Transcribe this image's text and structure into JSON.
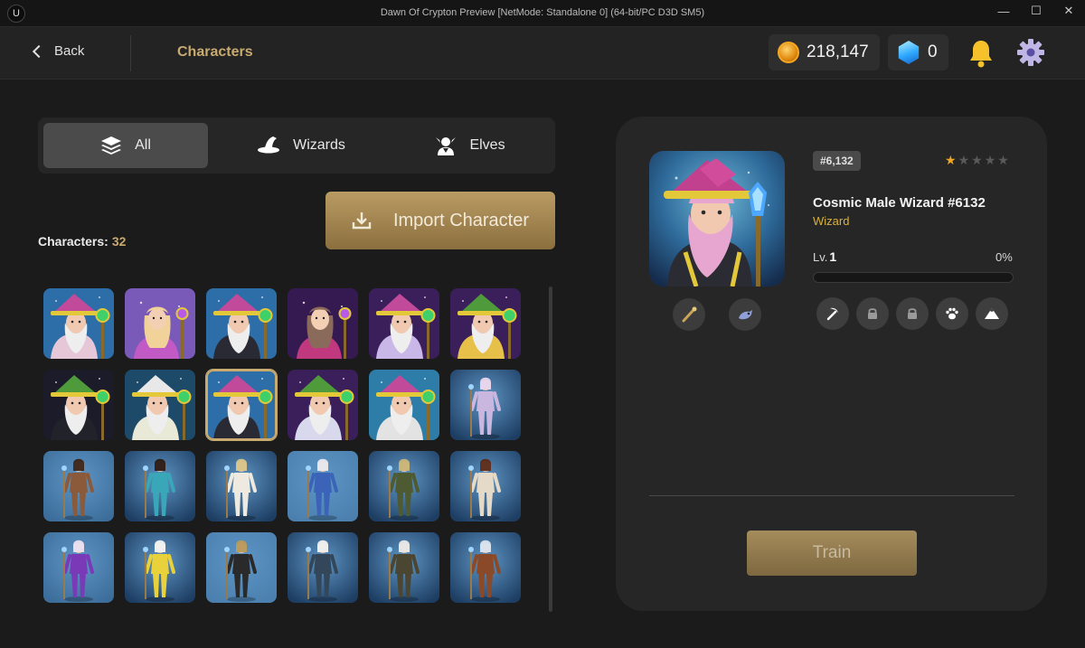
{
  "window": {
    "title": "Dawn Of Crypton Preview [NetMode: Standalone 0]  (64-bit/PC D3D SM5)",
    "logo": "U"
  },
  "header": {
    "back_label": "Back",
    "page_title": "Characters",
    "coins": "218,147",
    "gems": "0"
  },
  "tabs": [
    {
      "label": "All",
      "icon": "layers-icon",
      "active": true
    },
    {
      "label": "Wizards",
      "icon": "wizard-hat-icon",
      "active": false
    },
    {
      "label": "Elves",
      "icon": "elf-icon",
      "active": false
    }
  ],
  "import_label": "Import Character",
  "characters": {
    "label": "Characters:",
    "count": "32",
    "grid": [
      {
        "type": "wizard",
        "hat": "#c24a9a",
        "robe": "#e6c7d7",
        "bg": "#2d6ea8"
      },
      {
        "type": "sorceress",
        "hat": "#f1d39a",
        "robe": "#c25ac6",
        "bg": "#7a5ab8"
      },
      {
        "type": "wizard",
        "hat": "#c24a9a",
        "robe": "#2a2a35",
        "bg": "#2d6ea8"
      },
      {
        "type": "sorceress",
        "hat": "#8a6a5a",
        "robe": "#c0387e",
        "bg": "#351a52"
      },
      {
        "type": "wizard",
        "hat": "#c24a9a",
        "robe": "#c9b7e8",
        "bg": "#3a1f5a"
      },
      {
        "type": "wizard",
        "hat": "#4f9a3a",
        "robe": "#e7c04a",
        "bg": "#3a1f5a"
      },
      {
        "type": "wizard",
        "hat": "#4f9a3a",
        "robe": "#22222a",
        "bg": "#1b1b2a"
      },
      {
        "type": "wizard",
        "hat": "#e8e8e8",
        "robe": "#e9e9d8",
        "bg": "#1e4a6a"
      },
      {
        "type": "wizard",
        "hat": "#c24a9a",
        "robe": "#2a2a35",
        "bg": "#2d6ea8",
        "selected": true
      },
      {
        "type": "wizard",
        "hat": "#4f9a3a",
        "robe": "#d9d9ee",
        "bg": "#3a1f5a"
      },
      {
        "type": "wizard",
        "hat": "#c24a9a",
        "robe": "#e3e3e3",
        "bg": "#2d7da8"
      },
      {
        "type": "elf",
        "hair": "#e8d6ee",
        "outfit": "#c9b7e0",
        "bg": "#1d3d62"
      },
      {
        "type": "elf",
        "hair": "#3a2418",
        "outfit": "#8b5a3a",
        "bg": "#3c6d9a"
      },
      {
        "type": "elf",
        "hair": "#2a1a14",
        "outfit": "#3aa7b8",
        "bg": "#1d3d62"
      },
      {
        "type": "elf",
        "hair": "#d8c48a",
        "outfit": "#efeadf",
        "bg": "#1d3d62"
      },
      {
        "type": "elf",
        "hair": "#e8e8ee",
        "outfit": "#3b64b8",
        "bg": "#4a7fae"
      },
      {
        "type": "elf",
        "hair": "#c8b478",
        "outfit": "#4e5a32",
        "bg": "#1d3d62"
      },
      {
        "type": "elf",
        "hair": "#5a2a1a",
        "outfit": "#e5d9c8",
        "bg": "#1d3d62"
      },
      {
        "type": "elf",
        "hair": "#e9e0f0",
        "outfit": "#7a3ab8",
        "bg": "#3c6d9a"
      },
      {
        "type": "elf",
        "hair": "#f2f2f2",
        "outfit": "#e8d13a",
        "bg": "#1d3d62"
      },
      {
        "type": "elf",
        "hair": "#b89a5a",
        "outfit": "#2a2a2a",
        "bg": "#4a7fae"
      },
      {
        "type": "elf",
        "hair": "#f0f0f0",
        "outfit": "#34475a",
        "bg": "#1d3d62"
      },
      {
        "type": "elf",
        "hair": "#e8e8e8",
        "outfit": "#4a4632",
        "bg": "#1d3d62"
      },
      {
        "type": "elf",
        "hair": "#d9e4ee",
        "outfit": "#8a4a2a",
        "bg": "#1d3d62"
      }
    ]
  },
  "detail": {
    "id_badge": "#6,132",
    "rating": 1,
    "rating_max": 5,
    "name": "Cosmic Male Wizard #6132",
    "class": "Wizard",
    "level_prefix": "Lv.",
    "level": "1",
    "xp_percent_label": "0%",
    "xp_fraction": 0,
    "train_label": "Train",
    "colors": {
      "accent": "#c9aa6f",
      "class": "#d9b23a"
    }
  }
}
